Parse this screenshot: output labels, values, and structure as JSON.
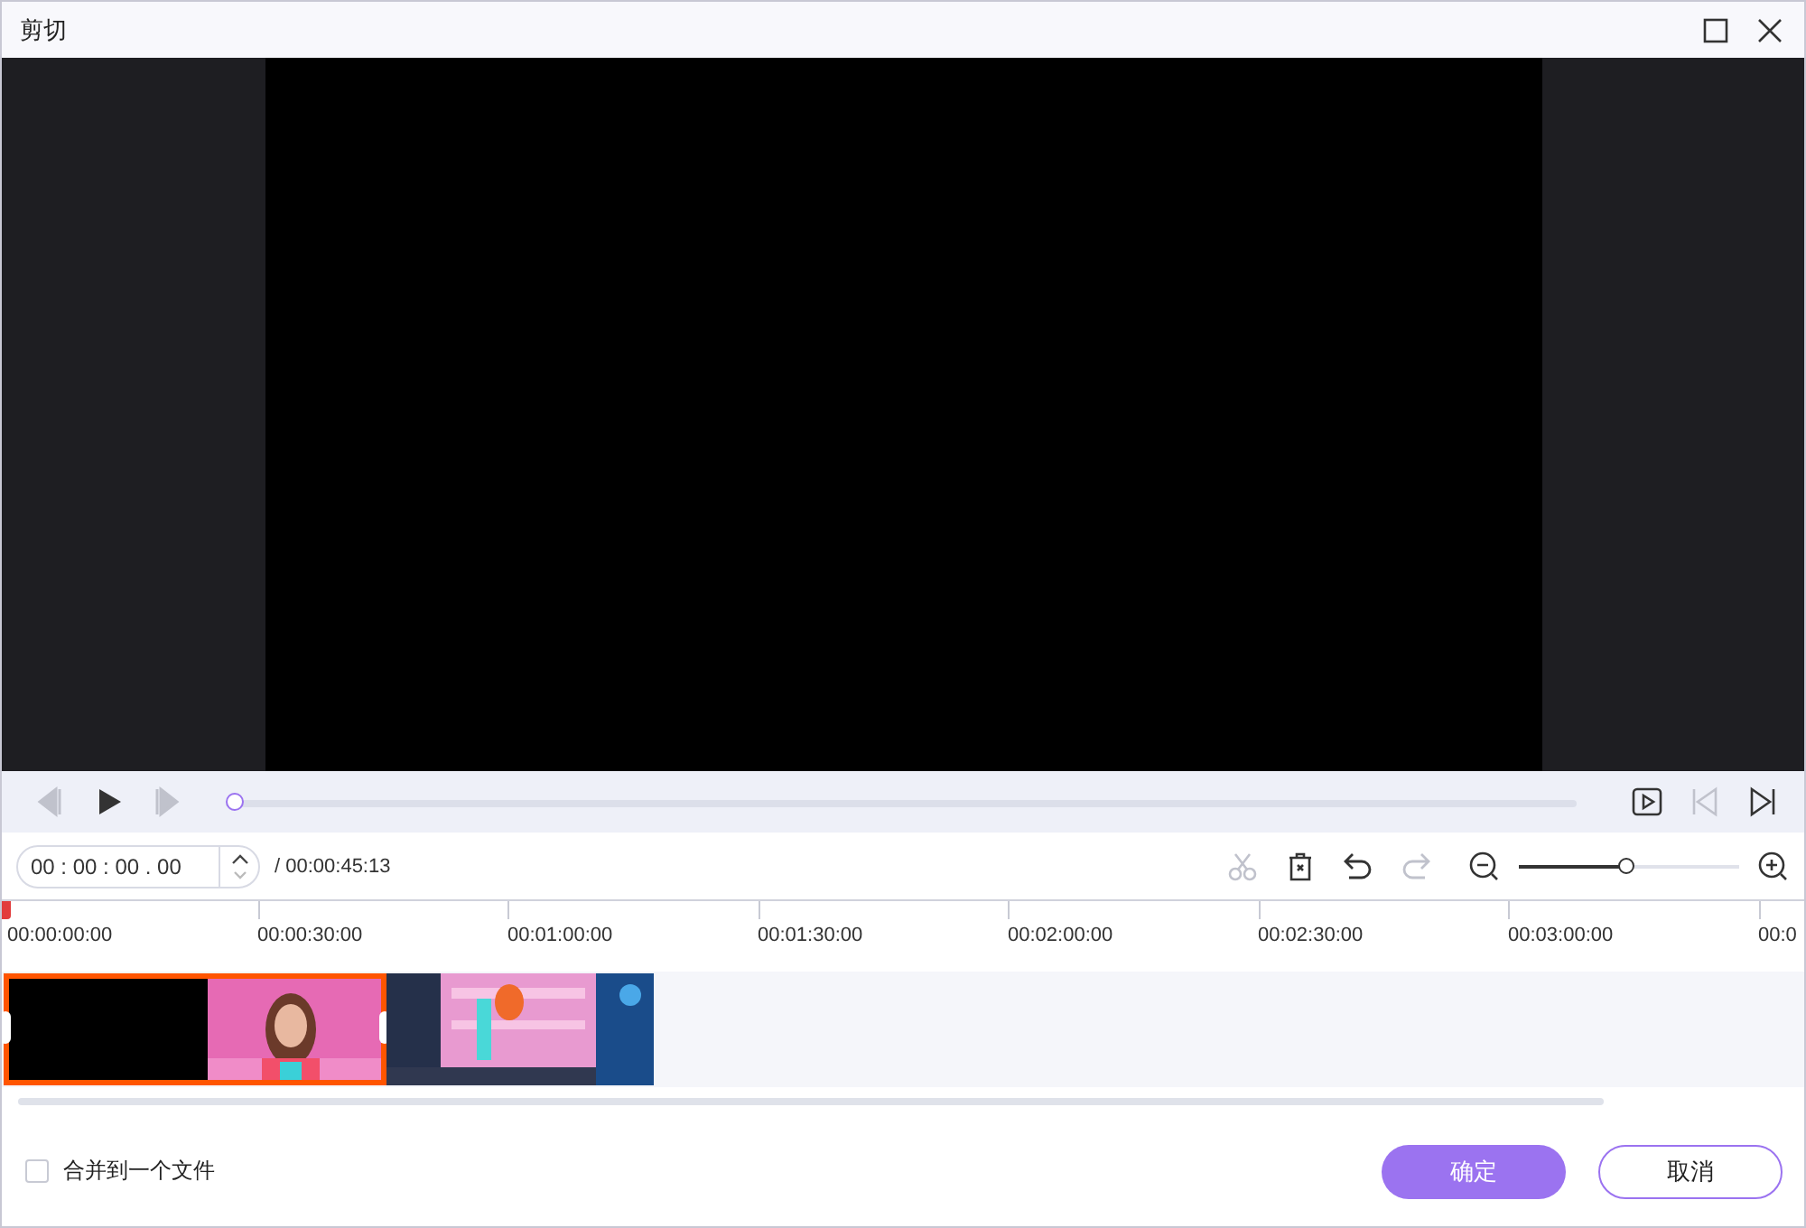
{
  "window": {
    "title": "剪切"
  },
  "player": {
    "progress": {
      "level": 0
    },
    "buttons": [
      {
        "kind": "prev-frame",
        "disabled": true
      },
      {
        "kind": "play",
        "disabled": false
      },
      {
        "kind": "next-frame",
        "disabled": true
      }
    ],
    "right_buttons": [
      {
        "kind": "preview",
        "disabled": false
      },
      {
        "kind": "to-start",
        "disabled": true
      },
      {
        "kind": "to-end",
        "disabled": false
      }
    ]
  },
  "time_field": {
    "value": "00 : 00 : 00 . 00",
    "total": "/ 00:00:45:13"
  },
  "tools": [
    {
      "kind": "cut",
      "disabled": true
    },
    {
      "kind": "delete",
      "disabled": false
    },
    {
      "kind": "undo",
      "disabled": false
    },
    {
      "kind": "redo",
      "disabled": true
    }
  ],
  "zoom": {
    "level": 0.48
  },
  "ruler": [
    "00:00:00:00",
    "00:00:30:00",
    "00:01:00:00",
    "00:01:30:00",
    "00:02:00:00",
    "00:02:30:00",
    "00:03:00:00",
    "00:0"
  ],
  "clips": [
    {
      "kind": "picture",
      "selected": true
    },
    {
      "kind": "picture",
      "selected": false
    }
  ],
  "merge": {
    "label": "合并到一个文件",
    "checked": false
  },
  "buttons": [
    {
      "label": "确定",
      "kind": "primary"
    },
    {
      "label": "取消",
      "kind": "secondary"
    }
  ]
}
